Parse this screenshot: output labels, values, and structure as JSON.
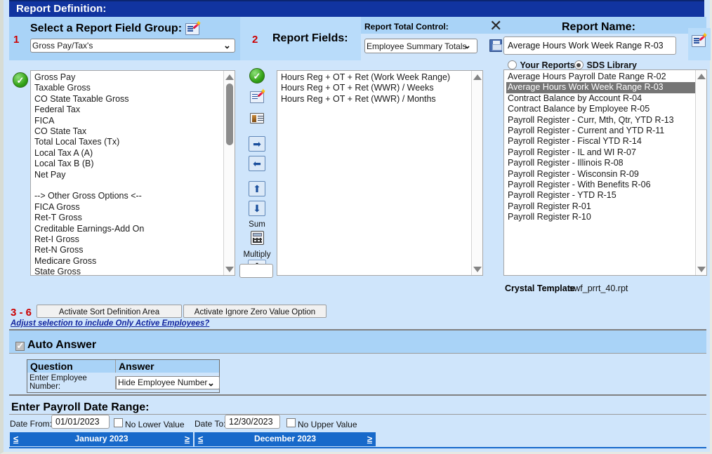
{
  "window": {
    "title": "Report Definition:"
  },
  "steps": {
    "one": "1",
    "two": "2",
    "three_six": "3 - 6"
  },
  "field_group": {
    "label": "Select a Report Field Group:",
    "edit_icon": "edit-wizard-icon",
    "selected": "Gross Pay/Tax's"
  },
  "report_fields": {
    "label": "Report Fields:",
    "available": [
      "Gross Pay",
      "Taxable Gross",
      "CO State Taxable Gross",
      "Federal Tax",
      "FICA",
      "CO State Tax",
      "Total Local Taxes (Tx)",
      "Local Tax A (A)",
      "Local Tax B (B)",
      "Net Pay",
      "",
      "--> Other Gross Options <--",
      "FICA Gross",
      "Ret-T Gross",
      "Creditable Earnings-Add On",
      "Ret-I Gross",
      "Ret-N Gross",
      "Medicare Gross",
      "State Gross"
    ],
    "selected_fields": [
      "Hours Reg + OT + Ret (Work Week Range)",
      "Hours Reg + OT + Ret (WWR) / Weeks",
      "Hours Reg + OT + Ret (WWR) / Months"
    ],
    "toolbar": {
      "sum_label": "Sum",
      "multiply_label": "Multiply",
      "multiply_symbol": "✱",
      "multiply_value": ""
    }
  },
  "report_total_control": {
    "label": "Report Total Control:",
    "selected": "Employee Summary Totals"
  },
  "report_name": {
    "label": "Report Name:",
    "value": "Average Hours Work Week Range R-03",
    "source_your_reports": "Your Reports",
    "source_sds_library": "SDS Library",
    "selected_source": "SDS Library",
    "list": [
      "Average Hours Payroll Date Range R-02",
      "Average Hours Work Week Range R-03",
      "Contract Balance by Account R-04",
      "Contract Balance by Employee R-05",
      "Payroll Register - Curr, Mth, Qtr, YTD R-13",
      "Payroll Register - Current and YTD R-11",
      "Payroll Register - Fiscal YTD R-14",
      "Payroll Register - IL and WI R-07",
      "Payroll Register - Illinois R-08",
      "Payroll Register - Wisconsin R-09",
      "Payroll Register - With Benefits R-06",
      "Payroll Register - YTD R-15",
      "Payroll Register R-01",
      "Payroll Register R-10"
    ],
    "selected_report": "Average Hours Work Week Range R-03",
    "crystal_template_label": "Crystal Template",
    "crystal_template_value": "swf_prrt_40.rpt"
  },
  "actions": {
    "sort_button": "Activate Sort Definition Area",
    "ignore_zero_button": "Activate Ignore Zero Value Option",
    "active_employees_link": "Adjust selection to include Only Active Employees?"
  },
  "auto_answer": {
    "title": "Auto Answer",
    "checked": true,
    "columns": [
      "Question",
      "Answer"
    ],
    "rows": [
      {
        "question": "Enter Employee Number:",
        "answer": "Hide Employee Number"
      }
    ]
  },
  "date_range": {
    "title": "Enter Payroll Date Range:",
    "from_label": "Date From:",
    "from_value": "01/01/2023",
    "no_lower_label": "No Lower Value",
    "no_lower_checked": false,
    "to_label": "Date To:",
    "to_value": "12/30/2023",
    "no_upper_label": "No Upper Value",
    "no_upper_checked": false,
    "from_month": "January 2023",
    "to_month": "December 2023",
    "prev_symbol": "≤",
    "next_symbol": "≥"
  },
  "colors": {
    "title_bar": "#1134a0",
    "panel_blue": "#a9d3f7",
    "body_blue": "#cfe5fb",
    "accent_red": "#cc0000",
    "month_bar": "#1769ca",
    "link_blue": "#12249e",
    "selection_gray": "#757575"
  }
}
